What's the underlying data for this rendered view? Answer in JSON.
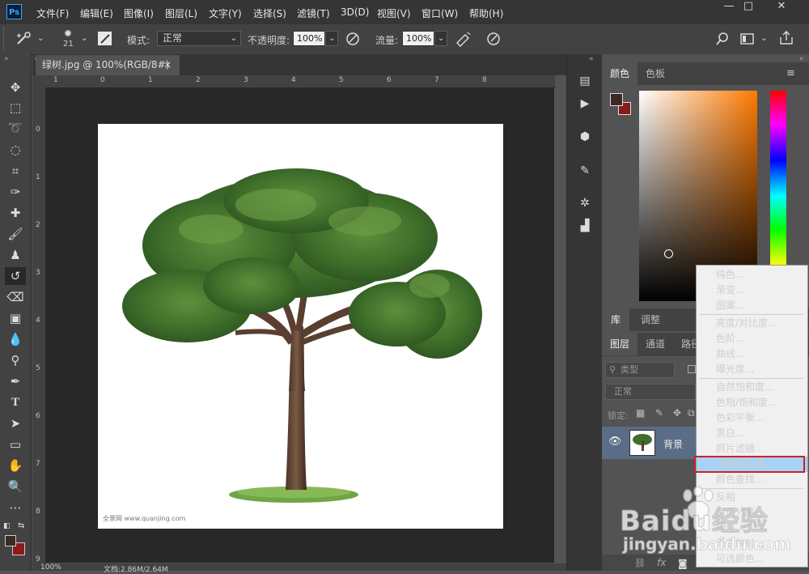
{
  "app": {
    "logo": "Ps"
  },
  "menu": [
    "文件(F)",
    "编辑(E)",
    "图像(I)",
    "图层(L)",
    "文字(Y)",
    "选择(S)",
    "滤镜(T)",
    "3D(D)",
    "视图(V)",
    "窗口(W)",
    "帮助(H)"
  ],
  "window_controls": {
    "minimize": "—",
    "restore": "□",
    "close": "✕"
  },
  "options": {
    "brush_size": "21",
    "mode_label": "模式:",
    "mode_value": "正常",
    "opacity_label": "不透明度:",
    "opacity_value": "100%",
    "flow_label": "流量:",
    "flow_value": "100%"
  },
  "document": {
    "tab_title": "绿树.jpg @ 100%(RGB/8#)",
    "tab_close": "×",
    "watermark": "全景网 www.quanjing.com",
    "zoom": "100%",
    "doc_info": "文档:2.86M/2.64M"
  },
  "rulers": {
    "h_ticks": [
      "1",
      "0",
      "1",
      "2",
      "3",
      "4",
      "5",
      "6",
      "7",
      "8"
    ],
    "v_ticks": [
      "0",
      "1",
      "2",
      "3",
      "4",
      "5",
      "6",
      "7",
      "8",
      "9"
    ]
  },
  "color_panel": {
    "tab_color": "颜色",
    "tab_swatches": "色板"
  },
  "library_panel": {
    "tab_library": "库",
    "tab_adjust": "调整"
  },
  "layers_panel": {
    "tab_layers": "图层",
    "tab_channels": "通道",
    "tab_paths": "路径",
    "filter_placeholder": "类型",
    "blend_mode": "正常",
    "lock_label": "锁定:",
    "layer_name": "背景"
  },
  "context_menu": {
    "groups": [
      [
        "纯色...",
        "渐变...",
        "图案..."
      ],
      [
        "亮度/对比度...",
        "色阶...",
        "曲线...",
        "曝光度..."
      ],
      [
        "自然饱和度...",
        "色相/饱和度...",
        "色彩平衡...",
        "黑白...",
        "照片滤镜...",
        "通道混合器...",
        "颜色查找..."
      ],
      [
        "反相",
        "色调分离...",
        "阈值...",
        "渐变映射...",
        "可选颜色..."
      ]
    ],
    "highlighted": "通道混合器..."
  },
  "site_watermark": {
    "brand": "Baidu经验",
    "url": "jingyan.baidu.com"
  },
  "colors": {
    "foreground": "#3b2a23",
    "background": "#8b1a1a",
    "highlight": "#a6d2f5",
    "highlight_border": "#d0202a"
  }
}
